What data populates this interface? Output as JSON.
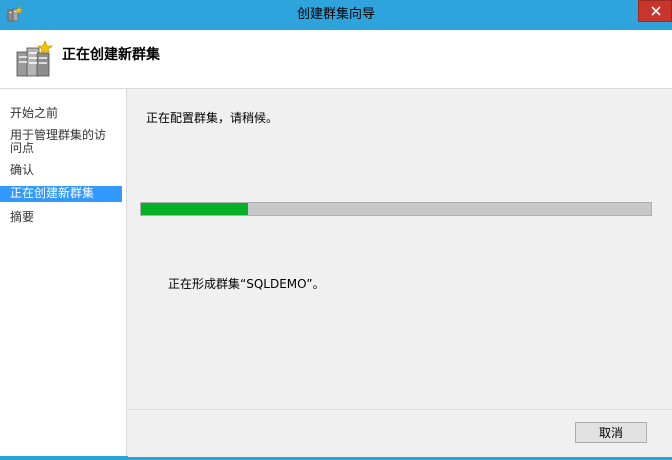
{
  "window": {
    "title": "创建群集向导",
    "close_icon": "close-icon"
  },
  "header": {
    "title": "正在创建新群集",
    "icon": "cluster-servers-icon"
  },
  "nav": {
    "items": [
      {
        "label": "开始之前",
        "active": false
      },
      {
        "label": "用于管理群集的访问点",
        "active": false
      },
      {
        "label": "确认",
        "active": false
      },
      {
        "label": "正在创建新群集",
        "active": true
      },
      {
        "label": "摘要",
        "active": false
      }
    ]
  },
  "main": {
    "status_text": "正在配置群集，请稍候。",
    "progress_percent": 21,
    "progress_color": "#06b025",
    "forming_text": "正在形成群集“SQLDEMO”。"
  },
  "footer": {
    "cancel_label": "取消"
  }
}
